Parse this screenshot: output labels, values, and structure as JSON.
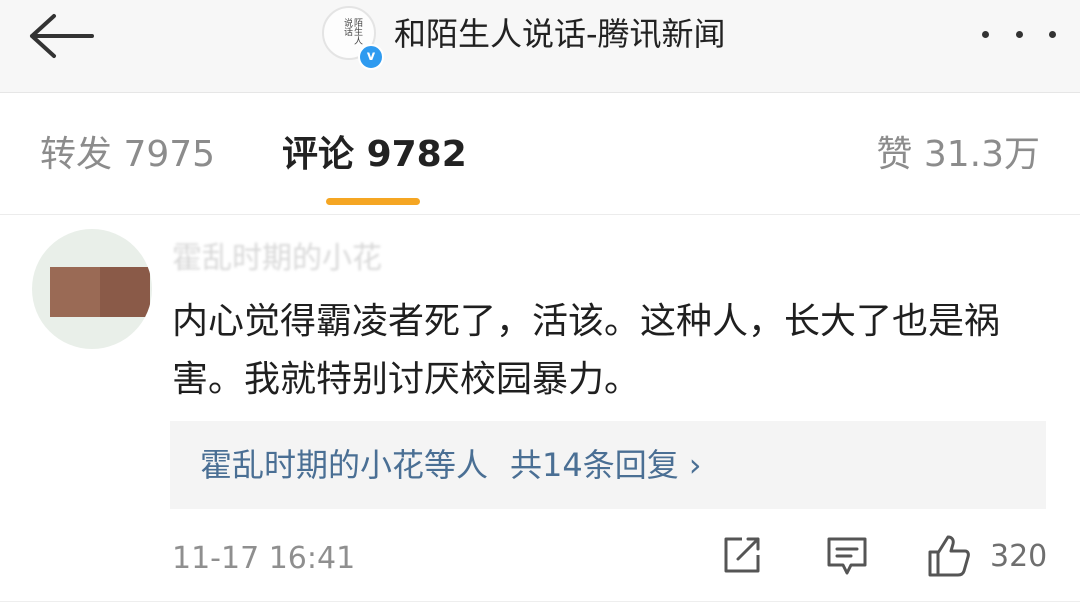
{
  "topbar": {
    "title": "和陌生人说话-腾讯新闻",
    "back_icon": "arrow-left-icon",
    "more_icon": "ellipsis-icon",
    "avatar_seal": "陌生人说话",
    "verified_mark": "v",
    "verified_color": "#2f9bf0"
  },
  "tabs": {
    "repost": "转发 7975",
    "comment_label": "评论",
    "comment_count": "9782",
    "likes": "赞 31.3万",
    "active_color": "#f5a623"
  },
  "comment": {
    "username": "霍乱时期的小花",
    "text": "内心觉得霸凌者死了，活该。这种人，长大了也是祸害。我就特别讨厌校园暴力。",
    "replies_names": "霍乱时期的小花等人",
    "replies_count": "共14条回复",
    "replies_chevron": "›",
    "time": "11-17 16:41",
    "like_count": "320",
    "link_color": "#4a6f94"
  }
}
